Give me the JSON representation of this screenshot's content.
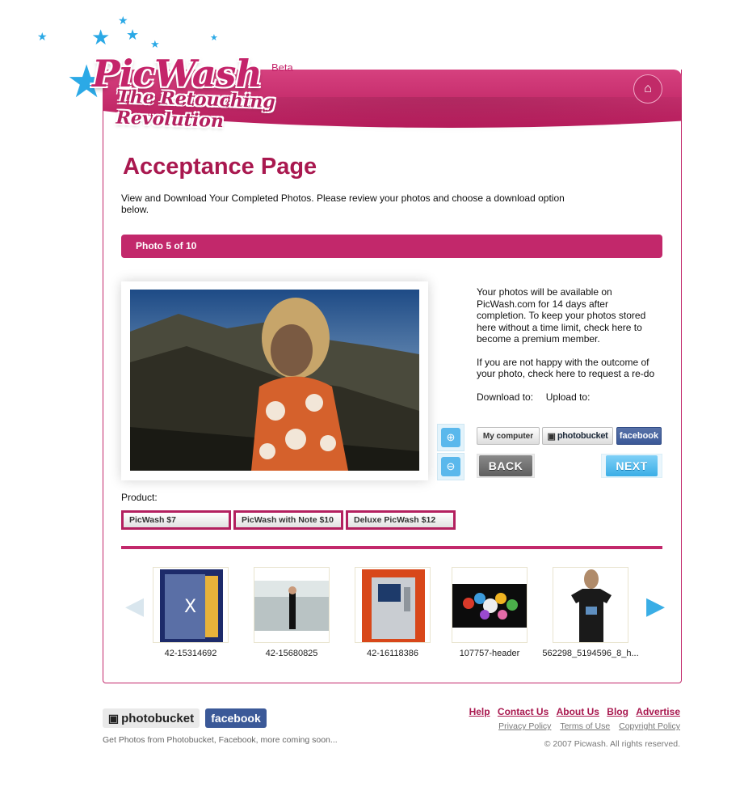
{
  "brand": {
    "name": "PicWash",
    "badge": "Beta",
    "tagline": "The Retouching Revolution",
    "accent": "#c2286b",
    "highlight": "#2ba9e6"
  },
  "header": {
    "home_icon": "home-icon"
  },
  "page": {
    "title": "Acceptance Page",
    "intro": "View and Download Your Completed Photos. Please review your photos and choose a download option below."
  },
  "photo_bar": {
    "label": "Photo 5 of 10"
  },
  "info": {
    "availability": "Your photos will be available on PicWash.com for 14 days after completion. To keep your photos stored here without a time limit, check here to become a premium member.",
    "redo": "If you are not happy with the outcome of your photo, check here to request a re-do",
    "download_label": "Download to:",
    "upload_label": "Upload to:"
  },
  "actions": {
    "my_computer": "My computer",
    "photobucket": "photobucket",
    "facebook": "facebook",
    "back": "BACK",
    "next": "NEXT"
  },
  "product": {
    "label": "Product:",
    "options": [
      "PicWash $7",
      "PicWash with Note $10",
      "Deluxe PicWash $12"
    ]
  },
  "thumbnails": [
    {
      "caption": "42-15314692"
    },
    {
      "caption": "42-15680825"
    },
    {
      "caption": "42-16118386"
    },
    {
      "caption": "107757-header"
    },
    {
      "caption": "562298_5194596_8_h..."
    }
  ],
  "footer": {
    "photobucket": "photobucket",
    "facebook": "facebook",
    "note": "Get Photos from Photobucket, Facebook, more coming soon...",
    "links": [
      "Help",
      "Contact Us",
      "About Us",
      "Blog",
      "Advertise"
    ],
    "legal": [
      "Privacy Policy",
      "Terms of Use",
      "Copyright Policy"
    ],
    "copyright": "© 2007 Picwash. All rights reserved."
  }
}
